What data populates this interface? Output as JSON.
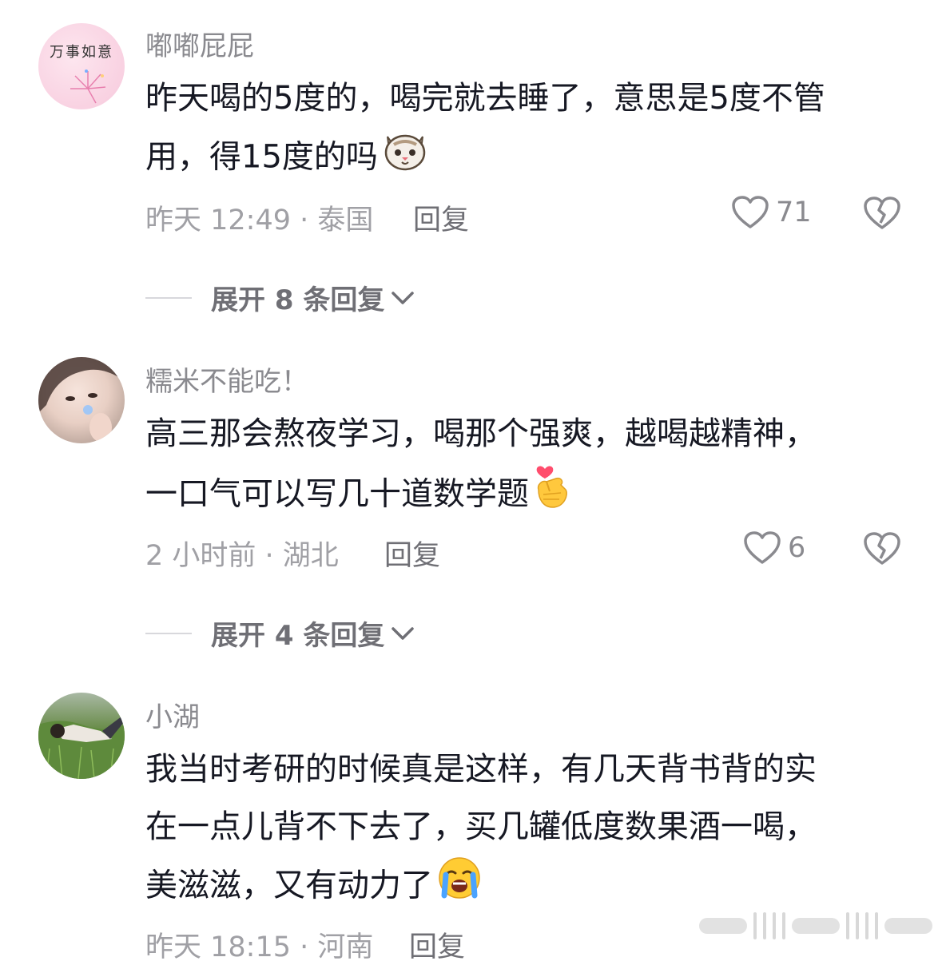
{
  "comments": [
    {
      "username": "嘟嘟屁屁",
      "avatar_text": "万事如意",
      "lines": [
        "昨天喝的5度的，喝完就去睡了，意思是5度不管",
        "用，得15度的吗"
      ],
      "emoji": "cat-face-emoji",
      "time_location": "昨天 12:49 · 泰国",
      "reply_label": "回复",
      "likes": "71",
      "expand_label": "展开 8 条回复"
    },
    {
      "username": "糯米不能吃！",
      "lines": [
        "高三那会熬夜学习，喝那个强爽，越喝越精神，",
        "一口气可以写几十道数学题"
      ],
      "emoji": "finger-heart-emoji",
      "time_location": "2 小时前 · 湖北",
      "reply_label": "回复",
      "likes": "6",
      "expand_label": "展开 4 条回复"
    },
    {
      "username": "小湖",
      "lines": [
        "我当时考研的时候真是这样，有几天背书背的实",
        "在一点儿背不下去了，买几罐低度数果酒一喝，",
        "美滋滋，又有动力了"
      ],
      "emoji": "crying-face-emoji",
      "time_location": "昨天 18:15 · 河南",
      "reply_label": "回复"
    }
  ],
  "colors": {
    "text": "#161823",
    "secondary": "#8a8a8f",
    "muted": "#a0a0a5"
  },
  "icons": [
    "heart-outline-icon",
    "broken-heart-icon",
    "chevron-down-icon"
  ]
}
